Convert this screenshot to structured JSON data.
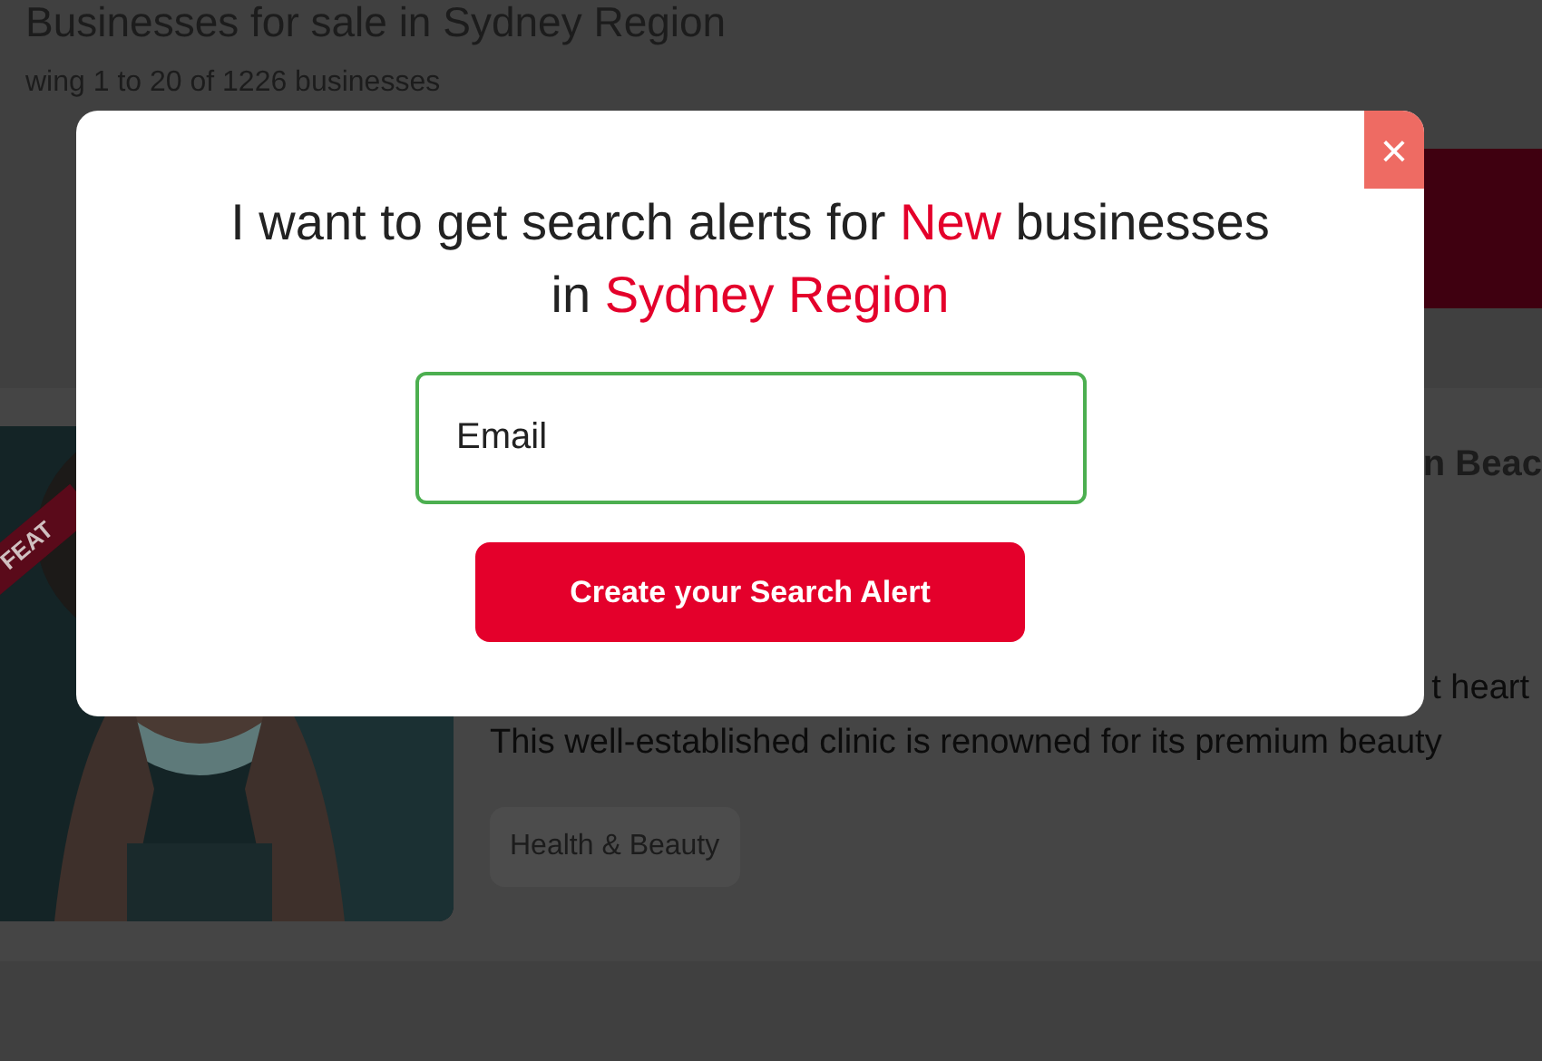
{
  "page": {
    "heading": "Businesses for sale in Sydney Region",
    "results_count": "wing 1 to 20 of 1226 businesses"
  },
  "listing": {
    "kind": "picture",
    "ribbon": "FEAT",
    "title": "n Beac",
    "description_lines": [
      "t heart",
      "This well-established clinic is renowned for its premium beauty"
    ],
    "tag": "Health & Beauty"
  },
  "modal": {
    "close": "×",
    "title_parts": [
      {
        "text": "I want to get search alerts for ",
        "highlight": false
      },
      {
        "text": "New",
        "highlight": true
      },
      {
        "text": " businesses in ",
        "highlight": false
      },
      {
        "text": "Sydney Region",
        "highlight": true
      }
    ],
    "email": {
      "placeholder": "Email"
    },
    "submit": "Create your Search Alert"
  }
}
